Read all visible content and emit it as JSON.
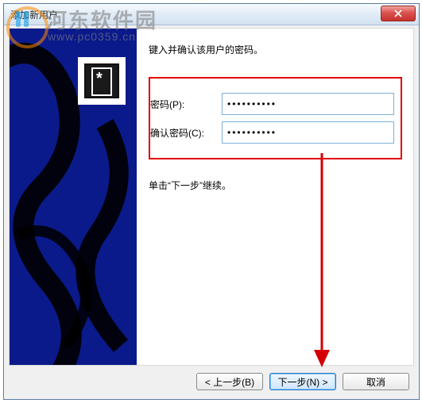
{
  "watermark": {
    "text": "河东软件园",
    "sub": "www.pc0359.cn"
  },
  "dialog": {
    "title": "添加新用户",
    "close_label": "X"
  },
  "content": {
    "instruction": "键入并确认该用户的密码。",
    "password_label": "密码(P):",
    "password_value": "••••••••••",
    "confirm_label": "确认密码(C):",
    "confirm_value": "••••••••••",
    "hint": "单击“下一步”继续。"
  },
  "buttons": {
    "back": "< 上一步(B)",
    "next": "下一步(N) >",
    "cancel": "取消"
  },
  "colors": {
    "highlight": "#e30000",
    "sidebar": "#0b1a8a",
    "arrow": "#d40000"
  }
}
